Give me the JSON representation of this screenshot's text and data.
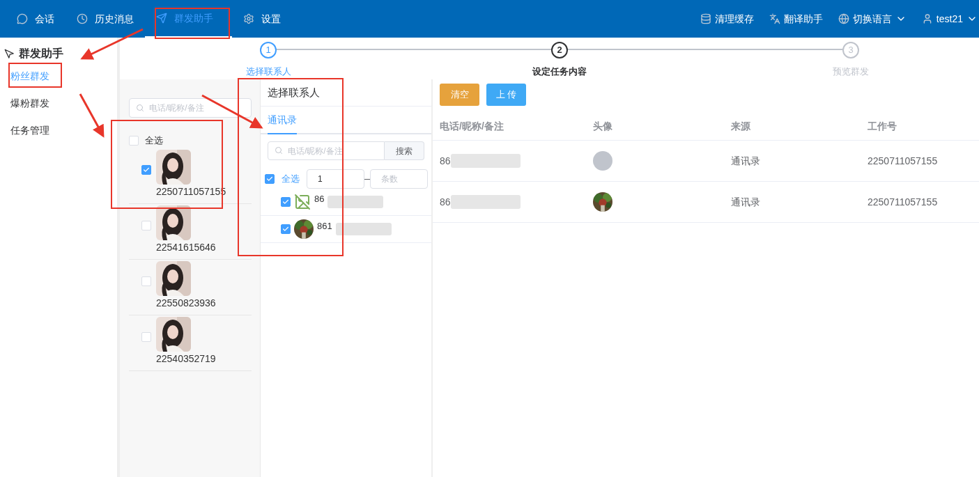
{
  "nav": {
    "items": [
      {
        "label": "会话",
        "selected": false
      },
      {
        "label": "历史消息",
        "selected": false
      },
      {
        "label": "群发助手",
        "selected": true
      },
      {
        "label": "设置",
        "selected": false
      }
    ],
    "tools": [
      {
        "label": "清理缓存",
        "dropdown": false
      },
      {
        "label": "翻译助手",
        "dropdown": false
      },
      {
        "label": "切换语言",
        "dropdown": true
      },
      {
        "label": "test21",
        "dropdown": true
      }
    ]
  },
  "sidebar": {
    "title": "群发助手",
    "items": [
      {
        "label": "粉丝群发",
        "selected": true
      },
      {
        "label": "爆粉群发",
        "selected": false
      },
      {
        "label": "任务管理",
        "selected": false
      }
    ]
  },
  "steps": [
    {
      "number": "1",
      "label": "选择联系人",
      "completed": true,
      "selected": false
    },
    {
      "number": "2",
      "label": "设定任务内容",
      "completed": false,
      "selected": true
    },
    {
      "number": "3",
      "label": "预览群发",
      "completed": false,
      "selected": false
    }
  ],
  "fans_panel": {
    "search": {
      "placeholder": "电话/昵称/备注"
    },
    "select_all": {
      "label": "全选",
      "checked": false
    },
    "fans": [
      {
        "id": "2250711057155",
        "checked": true
      },
      {
        "id": "22541615646",
        "checked": false
      },
      {
        "id": "22550823936",
        "checked": false
      },
      {
        "id": "22540352719",
        "checked": false
      }
    ]
  },
  "contact_picker": {
    "title": "选择联系人",
    "tabs": [
      {
        "label": "通讯录",
        "selected": true
      }
    ],
    "search": {
      "placeholder": "电话/昵称/备注",
      "button": "搜索"
    },
    "select_all": {
      "label": "全选",
      "checked": true
    },
    "range": {
      "start": "1",
      "end_placeholder": "条数"
    },
    "contacts": [
      {
        "phone": "86",
        "checked": true,
        "kind": "broken"
      },
      {
        "phone": "861",
        "checked": true
      }
    ]
  },
  "selected_panel": {
    "buttons": [
      {
        "label": "清空",
        "kind": "warning"
      },
      {
        "label": "上 传",
        "kind": "primary"
      }
    ],
    "columns": [
      "电话/昵称/备注",
      "头像",
      "来源",
      "工作号"
    ],
    "rows": [
      {
        "phone": "86",
        "kind": "blank",
        "source": "通讯录",
        "account": "2250711057155"
      },
      {
        "phone": "86",
        "source": "通讯录",
        "account": "2250711057155"
      }
    ]
  }
}
